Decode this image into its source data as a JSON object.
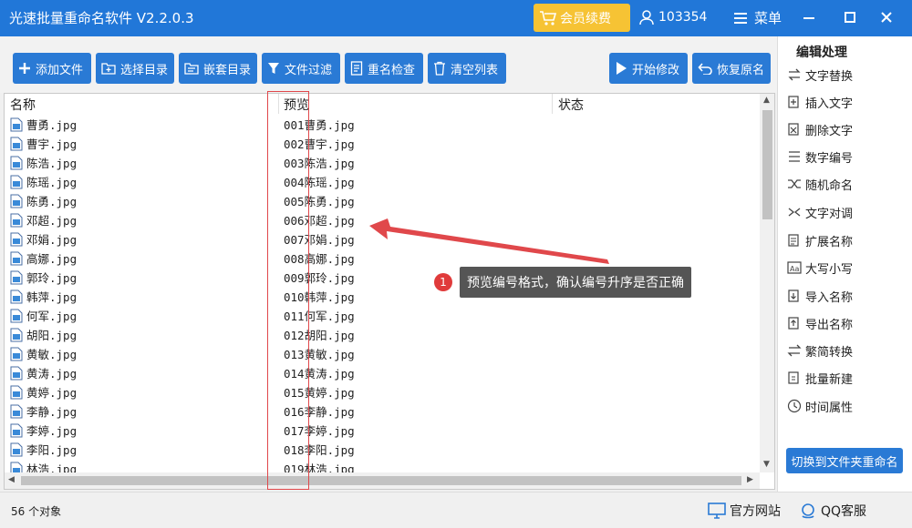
{
  "titlebar": {
    "title": "光速批量重命名软件 V2.2.0.3",
    "vip_label": "会员续费",
    "user_id": "103354",
    "menu_label": "菜单"
  },
  "toolbar": {
    "add_file": "添加文件",
    "select_dir": "选择目录",
    "nested_dir": "嵌套目录",
    "file_filter": "文件过滤",
    "dup_check": "重名检查",
    "clear_list": "清空列表",
    "start_modify": "开始修改",
    "restore_name": "恢复原名"
  },
  "list": {
    "headers": {
      "name": "名称",
      "preview": "预览",
      "status": "状态"
    },
    "rows": [
      {
        "name": "曹勇.jpg",
        "preview": "001曹勇.jpg"
      },
      {
        "name": "曹宇.jpg",
        "preview": "002曹宇.jpg"
      },
      {
        "name": "陈浩.jpg",
        "preview": "003陈浩.jpg"
      },
      {
        "name": "陈瑶.jpg",
        "preview": "004陈瑶.jpg"
      },
      {
        "name": "陈勇.jpg",
        "preview": "005陈勇.jpg"
      },
      {
        "name": "邓超.jpg",
        "preview": "006邓超.jpg"
      },
      {
        "name": "邓娟.jpg",
        "preview": "007邓娟.jpg"
      },
      {
        "name": "高娜.jpg",
        "preview": "008高娜.jpg"
      },
      {
        "name": "郭玲.jpg",
        "preview": "009郭玲.jpg"
      },
      {
        "name": "韩萍.jpg",
        "preview": "010韩萍.jpg"
      },
      {
        "name": "何军.jpg",
        "preview": "011何军.jpg"
      },
      {
        "name": "胡阳.jpg",
        "preview": "012胡阳.jpg"
      },
      {
        "name": "黄敏.jpg",
        "preview": "013黄敏.jpg"
      },
      {
        "name": "黄涛.jpg",
        "preview": "014黄涛.jpg"
      },
      {
        "name": "黄婷.jpg",
        "preview": "015黄婷.jpg"
      },
      {
        "name": "李静.jpg",
        "preview": "016李静.jpg"
      },
      {
        "name": "李婷.jpg",
        "preview": "017李婷.jpg"
      },
      {
        "name": "李阳.jpg",
        "preview": "018李阳.jpg"
      },
      {
        "name": "林浩.jpg",
        "preview": "019林浩.jpg"
      }
    ]
  },
  "annotation": {
    "number": "1",
    "text": "预览编号格式，确认编号升序是否正确"
  },
  "sidebar": {
    "title": "编辑处理",
    "items": [
      {
        "label": "文字替换",
        "icon": "replace-icon"
      },
      {
        "label": "插入文字",
        "icon": "insert-icon"
      },
      {
        "label": "删除文字",
        "icon": "delete-text-icon"
      },
      {
        "label": "数字编号",
        "icon": "numbering-icon"
      },
      {
        "label": "随机命名",
        "icon": "shuffle-icon"
      },
      {
        "label": "文字对调",
        "icon": "swap-icon"
      },
      {
        "label": "扩展名称",
        "icon": "extension-icon"
      },
      {
        "label": "大写小写",
        "icon": "case-icon"
      },
      {
        "label": "导入名称",
        "icon": "import-icon"
      },
      {
        "label": "导出名称",
        "icon": "export-icon"
      },
      {
        "label": "繁简转换",
        "icon": "convert-icon"
      },
      {
        "label": "批量新建",
        "icon": "batch-new-icon"
      },
      {
        "label": "时间属性",
        "icon": "clock-icon"
      }
    ],
    "switch_button": "切换到文件夹重命名"
  },
  "status": {
    "count": "56 个对象",
    "website": "官方网站",
    "qq": "QQ客服"
  },
  "colors": {
    "primary": "#2177d8",
    "button": "#2a7ad5",
    "vip": "#f6c334",
    "highlight": "#e0484b"
  }
}
